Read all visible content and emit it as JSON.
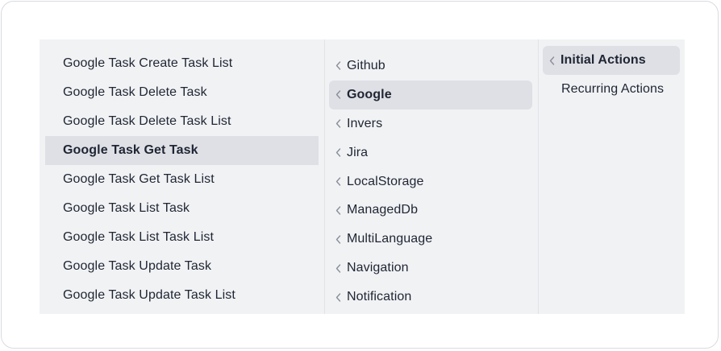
{
  "column_1": {
    "items": [
      {
        "label": "Google Task Create Task List"
      },
      {
        "label": "Google Task Delete Task"
      },
      {
        "label": "Google Task Delete Task List"
      },
      {
        "label": "Google Task Get Task",
        "active": true
      },
      {
        "label": "Google Task Get Task List"
      },
      {
        "label": "Google Task List Task"
      },
      {
        "label": "Google Task List Task List"
      },
      {
        "label": "Google Task Update Task"
      },
      {
        "label": "Google Task Update Task List"
      }
    ]
  },
  "column_2": {
    "items": [
      {
        "label": "Github",
        "icon": "chevron-left-icon"
      },
      {
        "label": "Google",
        "icon": "chevron-left-icon",
        "active": true
      },
      {
        "label": "Invers",
        "icon": "chevron-left-icon"
      },
      {
        "label": "Jira",
        "icon": "chevron-left-icon"
      },
      {
        "label": "LocalStorage",
        "icon": "chevron-left-icon"
      },
      {
        "label": "ManagedDb",
        "icon": "chevron-left-icon"
      },
      {
        "label": "MultiLanguage",
        "icon": "chevron-left-icon"
      },
      {
        "label": "Navigation",
        "icon": "chevron-left-icon"
      },
      {
        "label": "Notification",
        "icon": "chevron-left-icon"
      }
    ]
  },
  "column_3": {
    "items": [
      {
        "label": "Initial Actions",
        "icon": "chevron-left-icon",
        "active": true
      },
      {
        "label": "Recurring Actions"
      }
    ]
  },
  "colors": {
    "menu_bg": "#f1f2f4",
    "active_bg": "#dfe0e5",
    "text": "#1f2533",
    "chevron": "#8a8f99"
  }
}
